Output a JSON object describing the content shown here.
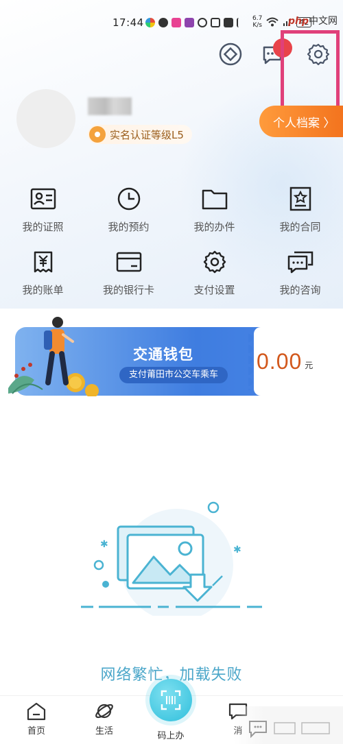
{
  "status_bar": {
    "time": "17:44",
    "net_speed_value": "6.7",
    "net_speed_unit": "K/s",
    "battery": "42",
    "watermark_logo": "php",
    "watermark_site": "中文网"
  },
  "header": {
    "notification_badge_color": "#e8434a",
    "highlight_color": "#e0407a"
  },
  "profile": {
    "cert_label": "实名认证等级L5",
    "archive_button": "个人档案 〉"
  },
  "grid": {
    "items": [
      {
        "label": "我的证照",
        "icon": "id-card-icon"
      },
      {
        "label": "我的预约",
        "icon": "clock-icon"
      },
      {
        "label": "我的办件",
        "icon": "folder-icon"
      },
      {
        "label": "我的合同",
        "icon": "contract-icon"
      },
      {
        "label": "我的账单",
        "icon": "bill-icon"
      },
      {
        "label": "我的银行卡",
        "icon": "bank-card-icon"
      },
      {
        "label": "支付设置",
        "icon": "gear-icon"
      },
      {
        "label": "我的咨询",
        "icon": "chat-icon"
      }
    ]
  },
  "wallet": {
    "title": "交通钱包",
    "subtitle": "支付莆田市公交车乘车",
    "balance": "0.00",
    "unit": "元"
  },
  "error": {
    "message": "网络繁忙，加载失败"
  },
  "bottom_nav": {
    "home": "首页",
    "life": "生活",
    "scan": "码上办",
    "message": "消"
  }
}
